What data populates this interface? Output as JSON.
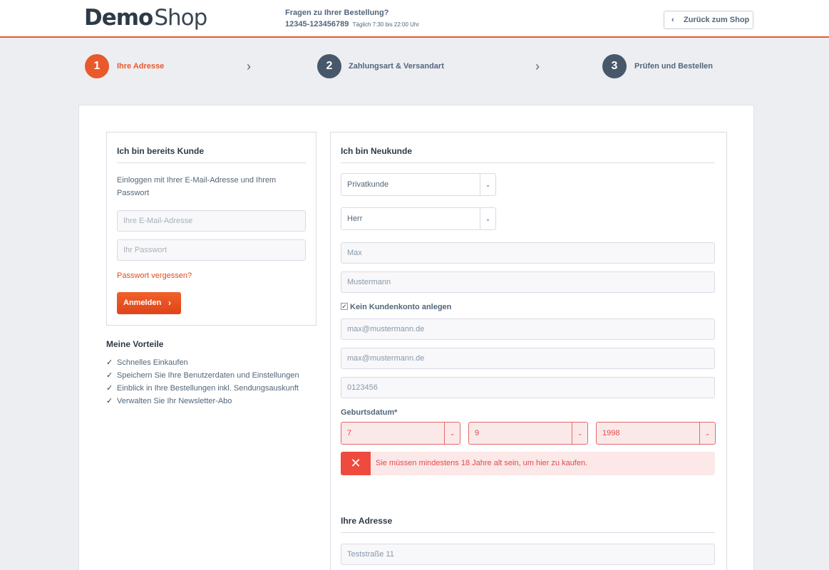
{
  "header": {
    "logo_bold": "Demo",
    "logo_light": "Shop",
    "help_title": "Fragen zu Ihrer Bestellung?",
    "help_phone": "12345-123456789",
    "help_hours": "Täglich 7:30 bis 22:00 Uhr",
    "back_button": "Zurück zum Shop"
  },
  "steps": [
    {
      "number": "1",
      "label": "Ihre Adresse",
      "active": true
    },
    {
      "number": "2",
      "label": "Zahlungsart & Versandart",
      "active": false
    },
    {
      "number": "3",
      "label": "Prüfen und Bestellen",
      "active": false
    }
  ],
  "login": {
    "title": "Ich bin bereits Kunde",
    "description_line1": "Einloggen mit Ihrer E-Mail-Adresse und Ihrem",
    "description_line2": "Passwort",
    "email_placeholder": "Ihre E-Mail-Adresse",
    "password_placeholder": "Ihr Passwort",
    "forgot_password": "Passwort vergessen?",
    "submit_label": "Anmelden"
  },
  "benefits": {
    "title": "Meine Vorteile",
    "items": [
      "Schnelles Einkaufen",
      "Speichern Sie Ihre Benutzerdaten und Einstellungen",
      "Einblick in Ihre Bestellungen inkl. Sendungsauskunft",
      "Verwalten Sie Ihr Newsletter-Abo"
    ]
  },
  "register": {
    "title": "Ich bin Neukunde",
    "customer_type": "Privatkunde",
    "salutation": "Herr",
    "firstname": "Max",
    "lastname": "Mustermann",
    "no_account_label": "Kein Kundenkonto anlegen",
    "no_account_checked": true,
    "email": "max@mustermann.de",
    "email_confirm": "max@mustermann.de",
    "phone": "0123456",
    "birthday_label": "Geburtsdatum*",
    "birthday_day": "7",
    "birthday_month": "9",
    "birthday_year": "1998",
    "error_message": "Sie müssen mindestens 18 Jahre alt sein, um hier zu kaufen."
  },
  "address": {
    "title": "Ihre Adresse",
    "street": "Teststraße 11"
  },
  "colors": {
    "accent": "#e8592b",
    "step_inactive": "#46586a",
    "error": "#ef4a3e",
    "error_bg": "#fce8e8"
  }
}
